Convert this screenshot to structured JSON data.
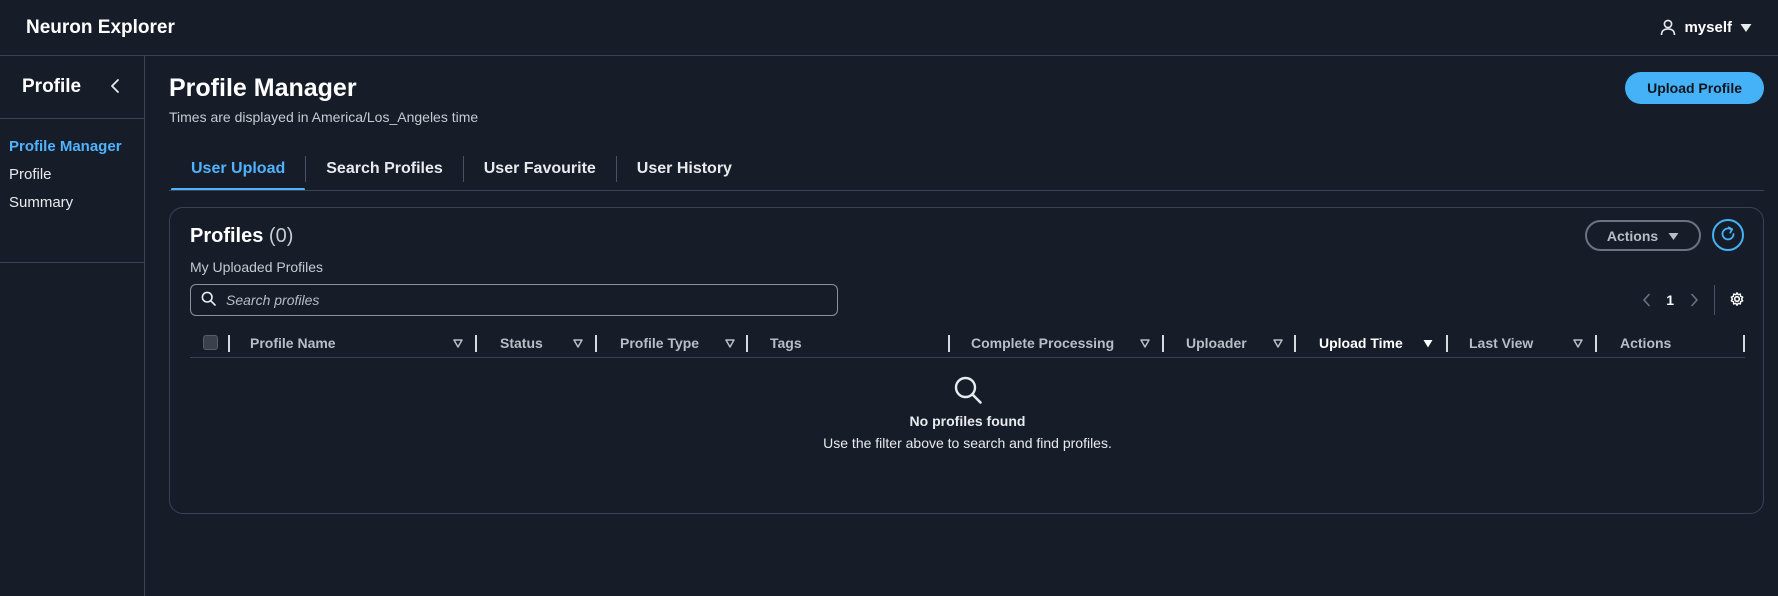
{
  "app": {
    "title": "Neuron Explorer"
  },
  "user": {
    "name": "myself"
  },
  "sidebar": {
    "title": "Profile",
    "items": [
      {
        "label": "Profile Manager",
        "active": true
      },
      {
        "label": "Profile",
        "active": false
      },
      {
        "label": "Summary",
        "active": false
      }
    ]
  },
  "page": {
    "title": "Profile Manager",
    "subtitle": "Times are displayed in America/Los_Angeles time",
    "upload_label": "Upload Profile"
  },
  "tabs": [
    {
      "label": "User Upload",
      "active": true
    },
    {
      "label": "Search Profiles",
      "active": false
    },
    {
      "label": "User Favourite",
      "active": false
    },
    {
      "label": "User History",
      "active": false
    }
  ],
  "panel": {
    "title": "Profiles",
    "count": "(0)",
    "subtitle": "My Uploaded Profiles",
    "actions_label": "Actions",
    "search_placeholder": "Search profiles",
    "current_page": "1"
  },
  "table": {
    "columns": [
      {
        "label": "Profile Name",
        "sortable": true
      },
      {
        "label": "Status",
        "sortable": true
      },
      {
        "label": "Profile Type",
        "sortable": true
      },
      {
        "label": "Tags",
        "sortable": false
      },
      {
        "label": "Complete Processing",
        "sortable": true
      },
      {
        "label": "Uploader",
        "sortable": true
      },
      {
        "label": "Upload Time",
        "sortable": true,
        "sorted": "desc"
      },
      {
        "label": "Last View",
        "sortable": true
      },
      {
        "label": "Actions",
        "sortable": false
      }
    ]
  },
  "empty": {
    "title": "No profiles found",
    "message": "Use the filter above to search and find profiles."
  },
  "colors": {
    "background": "#161d29",
    "accent": "#45b1f7",
    "border": "#3b4352"
  }
}
